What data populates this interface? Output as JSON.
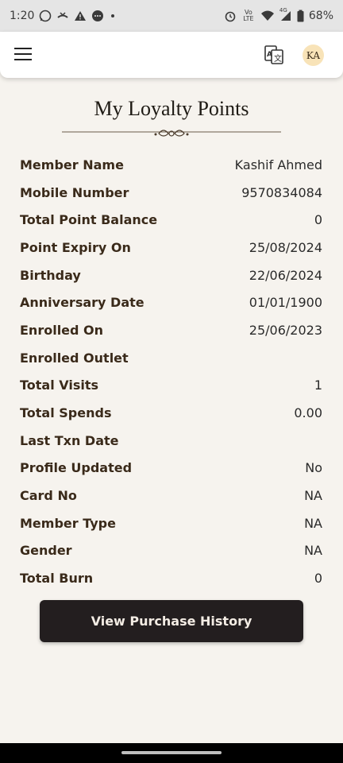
{
  "status_bar": {
    "time": "1:20",
    "battery_percent": "68%",
    "network_label": "Vo LTE",
    "signal_label": "4G",
    "icons": [
      "whatsapp-icon",
      "missed-call-icon",
      "warning-icon",
      "message-icon",
      "dot-icon",
      "alarm-icon",
      "volte-icon",
      "wifi-icon",
      "signal-icon",
      "battery-icon"
    ]
  },
  "header": {
    "menu_icon": "hamburger-menu-icon",
    "translate_icon": "translate-icon",
    "avatar_initials": "KA"
  },
  "page": {
    "title": "My Loyalty Points"
  },
  "rows": [
    {
      "label": "Member Name",
      "value": "Kashif Ahmed"
    },
    {
      "label": "Mobile Number",
      "value": "9570834084"
    },
    {
      "label": "Total Point Balance",
      "value": "0"
    },
    {
      "label": "Point Expiry On",
      "value": "25/08/2024"
    },
    {
      "label": "Birthday",
      "value": "22/06/2024"
    },
    {
      "label": "Anniversary Date",
      "value": "01/01/1900"
    },
    {
      "label": "Enrolled On",
      "value": "25/06/2023"
    },
    {
      "label": "Enrolled Outlet",
      "value": ""
    },
    {
      "label": "Total Visits",
      "value": "1"
    },
    {
      "label": "Total Spends",
      "value": "0.00"
    },
    {
      "label": "Last Txn Date",
      "value": ""
    },
    {
      "label": "Profile Updated",
      "value": "No"
    },
    {
      "label": "Card No",
      "value": "NA"
    },
    {
      "label": "Member Type",
      "value": "NA"
    },
    {
      "label": "Gender",
      "value": "NA"
    },
    {
      "label": "Total Burn",
      "value": "0"
    }
  ],
  "actions": {
    "view_purchase_history": "View Purchase History"
  },
  "colors": {
    "background": "#f6f3ee",
    "label_color": "#3a2a1a",
    "button_bg": "#231e1f",
    "avatar_bg": "#f8e3b8"
  }
}
